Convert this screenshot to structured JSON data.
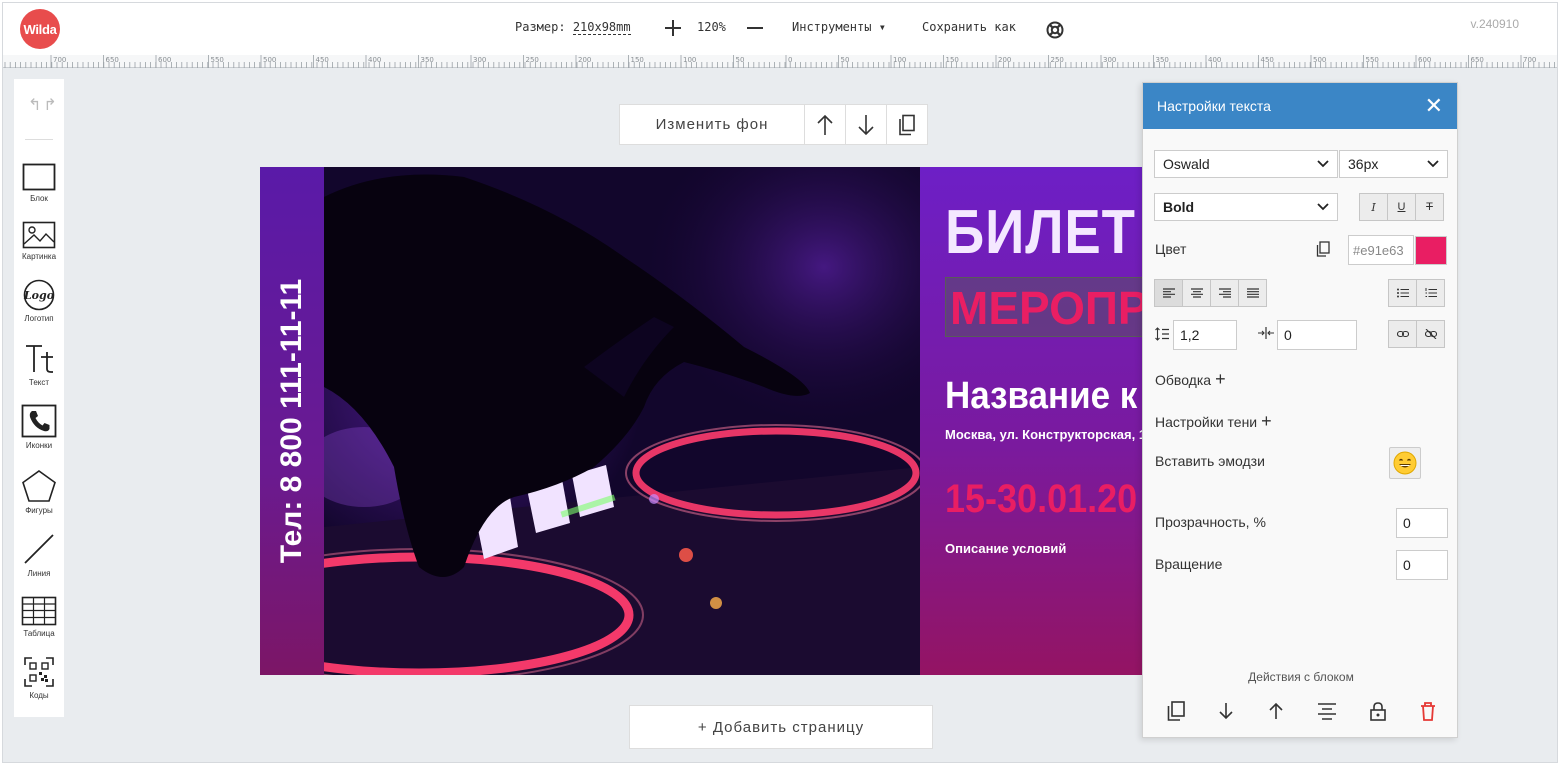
{
  "app": {
    "logo_text": "Wilda",
    "version": "v.240910"
  },
  "topbar": {
    "size_label": "Размер:",
    "size_value": "210x98mm",
    "zoom": "120%",
    "tools_label": "Инструменты ▾",
    "save_as_label": "Сохранить как"
  },
  "ruler": {
    "labels": [
      "700",
      "650",
      "600",
      "550",
      "500",
      "450",
      "400",
      "350",
      "300",
      "250",
      "200",
      "150",
      "100",
      "50",
      "0",
      "50",
      "100",
      "150",
      "200",
      "250",
      "300",
      "350",
      "400",
      "450",
      "500",
      "550",
      "600",
      "650",
      "700"
    ]
  },
  "sidebar": {
    "undo_redo": "↰↱",
    "tools": [
      {
        "label": "Блок",
        "icon": "rectangle-icon"
      },
      {
        "label": "Картинка",
        "icon": "image-icon"
      },
      {
        "label": "Логотип",
        "icon": "logo-icon"
      },
      {
        "label": "Текст",
        "icon": "text-icon"
      },
      {
        "label": "Иконки",
        "icon": "phone-icon"
      },
      {
        "label": "Фигуры",
        "icon": "pentagon-icon"
      },
      {
        "label": "Линия",
        "icon": "line-icon"
      },
      {
        "label": "Таблица",
        "icon": "table-icon"
      },
      {
        "label": "Коды",
        "icon": "qr-code-icon"
      }
    ],
    "logo_tool_glyph": "Logo"
  },
  "canvas": {
    "change_bg_label": "Изменить фон",
    "add_page_label": "+ Добавить страницу"
  },
  "ticket": {
    "phone": "Тел: 8 800 111-11-11",
    "title": "БИЛЕТ",
    "event": "МЕРОПРИЯ",
    "name": "Название к",
    "address": "Москва, ул. Конструкторская, 1.",
    "dates": "15-30.01.20",
    "description": "Описание условий",
    "colors": {
      "accent": "#e91e63",
      "title": "#f4e8ff",
      "bg_top": "#6d1fc6",
      "bg_bottom": "#941463"
    }
  },
  "panel": {
    "title": "Настройки текста",
    "font_family": "Oswald",
    "font_size": "36px",
    "font_weight": "Bold",
    "italic": "I",
    "underline": "U",
    "strike": "T",
    "color_label": "Цвет",
    "color_value": "#e91e63",
    "line_height": "1,2",
    "letter_spacing": "0",
    "stroke_label": "Обводка",
    "shadow_label": "Настройки тени",
    "emoji_label": "Вставить эмодзи",
    "emoji": "😄",
    "opacity_label": "Прозрачность, %",
    "opacity_value": "0",
    "rotation_label": "Вращение",
    "rotation_value": "0",
    "actions_title": "Действия с блоком",
    "colors": {
      "header": "#3b86c6",
      "delete": "#e53935"
    }
  }
}
